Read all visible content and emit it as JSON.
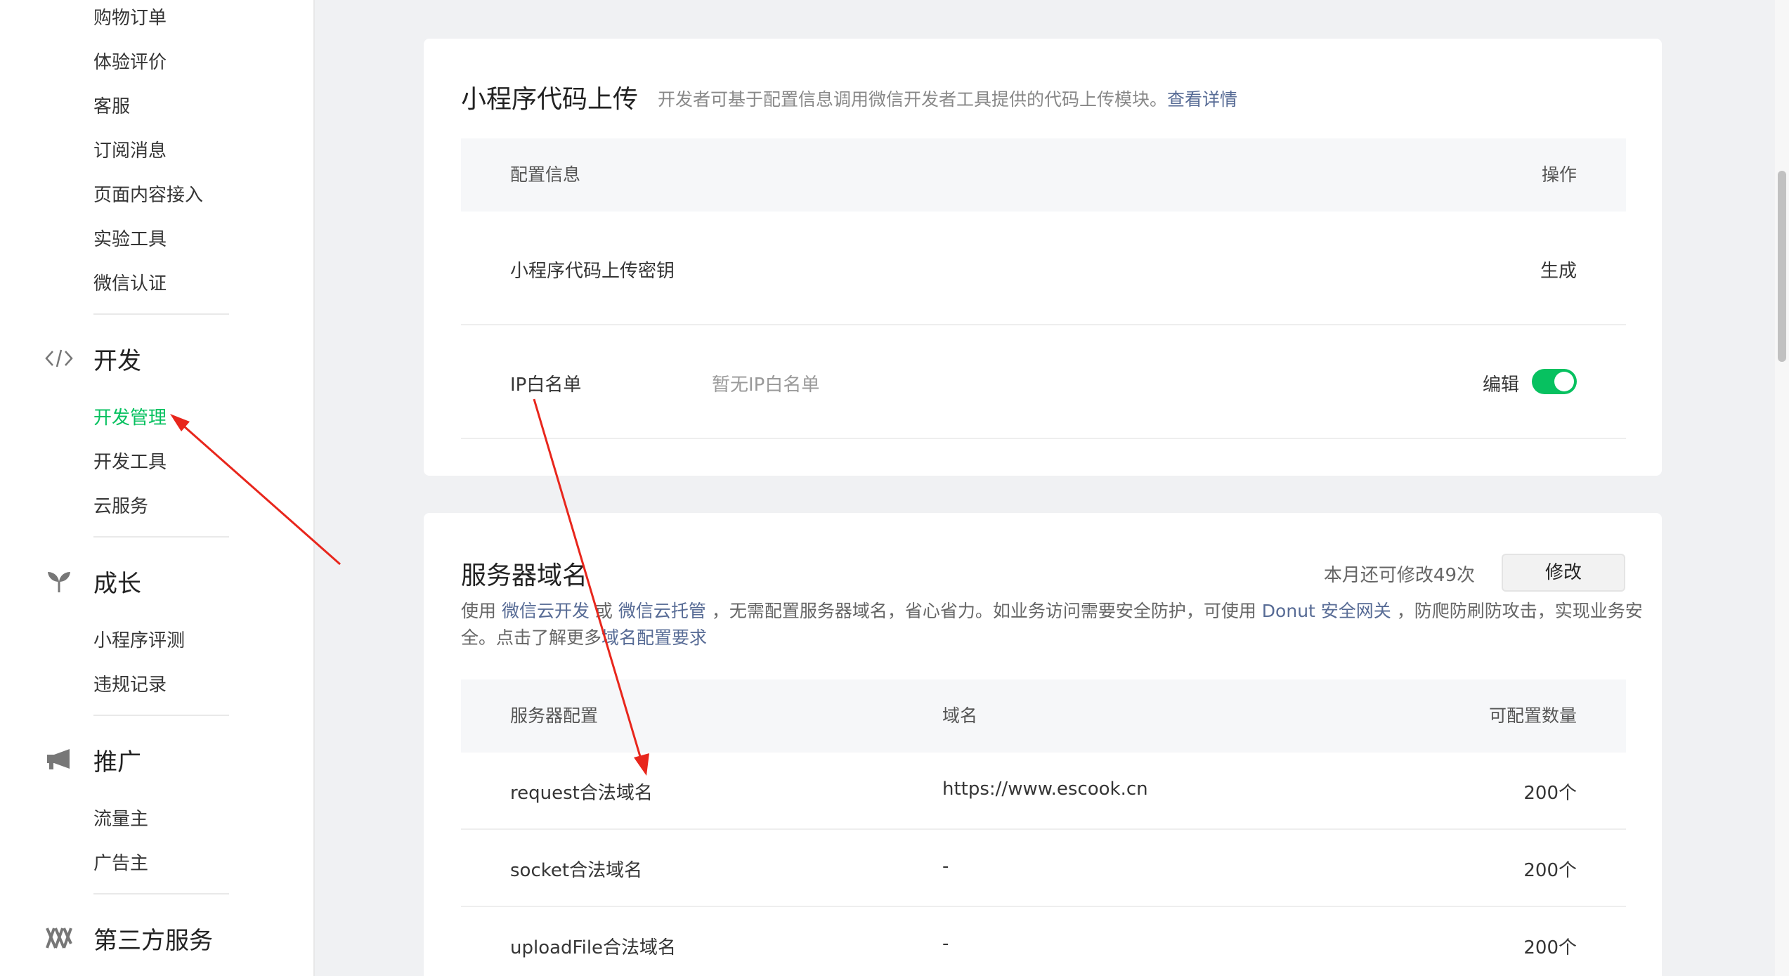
{
  "sidebar": {
    "items_top": [
      "购物订单",
      "体验评价",
      "客服",
      "订阅消息",
      "页面内容接入",
      "实验工具",
      "微信认证"
    ],
    "sections": [
      {
        "icon": "code-icon",
        "label": "开发",
        "items": [
          "开发管理",
          "开发工具",
          "云服务"
        ],
        "active_index": 0
      },
      {
        "icon": "sprout-icon",
        "label": "成长",
        "items": [
          "小程序评测",
          "违规记录"
        ]
      },
      {
        "icon": "megaphone-icon",
        "label": "推广",
        "items": [
          "流量主",
          "广告主"
        ]
      },
      {
        "icon": "third-party-icon",
        "label": "第三方服务",
        "items": []
      }
    ],
    "active_color": "#07c160"
  },
  "upload_card": {
    "title": "小程序代码上传",
    "desc": "开发者可基于配置信息调用微信开发者工具提供的代码上传模块。",
    "desc_link": "查看详情",
    "header_config": "配置信息",
    "header_action": "操作",
    "rows": [
      {
        "name": "小程序代码上传密钥",
        "value": "",
        "action": "生成"
      },
      {
        "name": "IP白名单",
        "value": "暂无IP白名单",
        "action": "编辑",
        "toggle_on": true
      }
    ]
  },
  "domain_card": {
    "title": "服务器域名",
    "quota_text": "本月还可修改49次",
    "modify_button": "修改",
    "desc_part1": "使用 ",
    "desc_link1": "微信云开发",
    "desc_part2": " 或 ",
    "desc_link2": "微信云托管",
    "desc_part3": " ，无需配置服务器域名，省心省力。如业务访问需要安全防护，可使用 ",
    "desc_link3": "Donut 安全网关",
    "desc_part4": " ，防爬防刷防攻击，实现业务安",
    "desc_line2_part": "全。点击了解更多",
    "desc_link4": "域名配置要求",
    "header_config": "服务器配置",
    "header_domain": "域名",
    "header_count": "可配置数量",
    "rows": [
      {
        "name": "request合法域名",
        "domain": "https://www.escook.cn",
        "count": "200个"
      },
      {
        "name": "socket合法域名",
        "domain": "-",
        "count": "200个"
      },
      {
        "name": "uploadFile合法域名",
        "domain": "-",
        "count": "200个"
      }
    ]
  },
  "colors": {
    "link": "#576b95",
    "annotation_arrow": "#e8261c",
    "toggle_on": "#07c160"
  }
}
